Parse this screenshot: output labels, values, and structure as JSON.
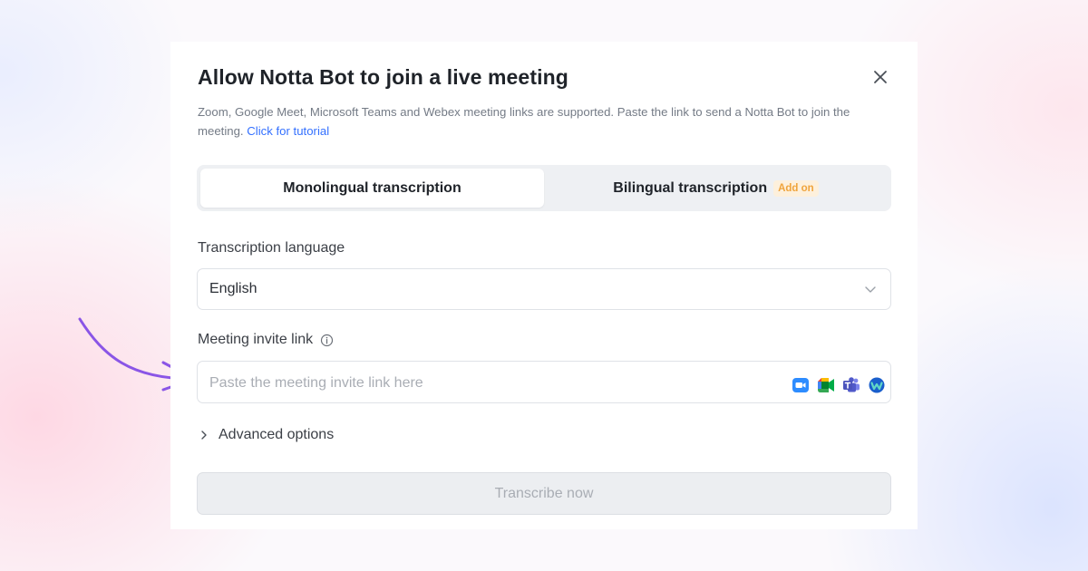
{
  "dialog": {
    "title": "Allow Notta Bot to join a live meeting",
    "description": "Zoom, Google Meet, Microsoft Teams and Webex meeting links are supported. Paste the link to send a Notta Bot to join the meeting.",
    "tutorial_link": "Click for tutorial",
    "close_icon": "close-icon"
  },
  "tabs": {
    "monolingual": "Monolingual transcription",
    "bilingual": "Bilingual transcription",
    "addon_badge": "Add on",
    "selected": "monolingual"
  },
  "language": {
    "label": "Transcription language",
    "value": "English",
    "icon": "chevron-down-icon"
  },
  "invite": {
    "label": "Meeting invite link",
    "placeholder": "Paste the meeting invite link here",
    "info_icon": "info-icon",
    "platform_icons": [
      "zoom-icon",
      "google-meet-icon",
      "microsoft-teams-icon",
      "webex-icon"
    ]
  },
  "advanced": {
    "label": "Advanced options",
    "icon": "chevron-right-icon"
  },
  "submit": {
    "label": "Transcribe now",
    "disabled": true
  },
  "colors": {
    "accent_link": "#3370ff",
    "addon_badge_text": "#f0a43c",
    "addon_badge_bg": "#fdf0dc",
    "arrow_annotation": "#8a55e6"
  }
}
